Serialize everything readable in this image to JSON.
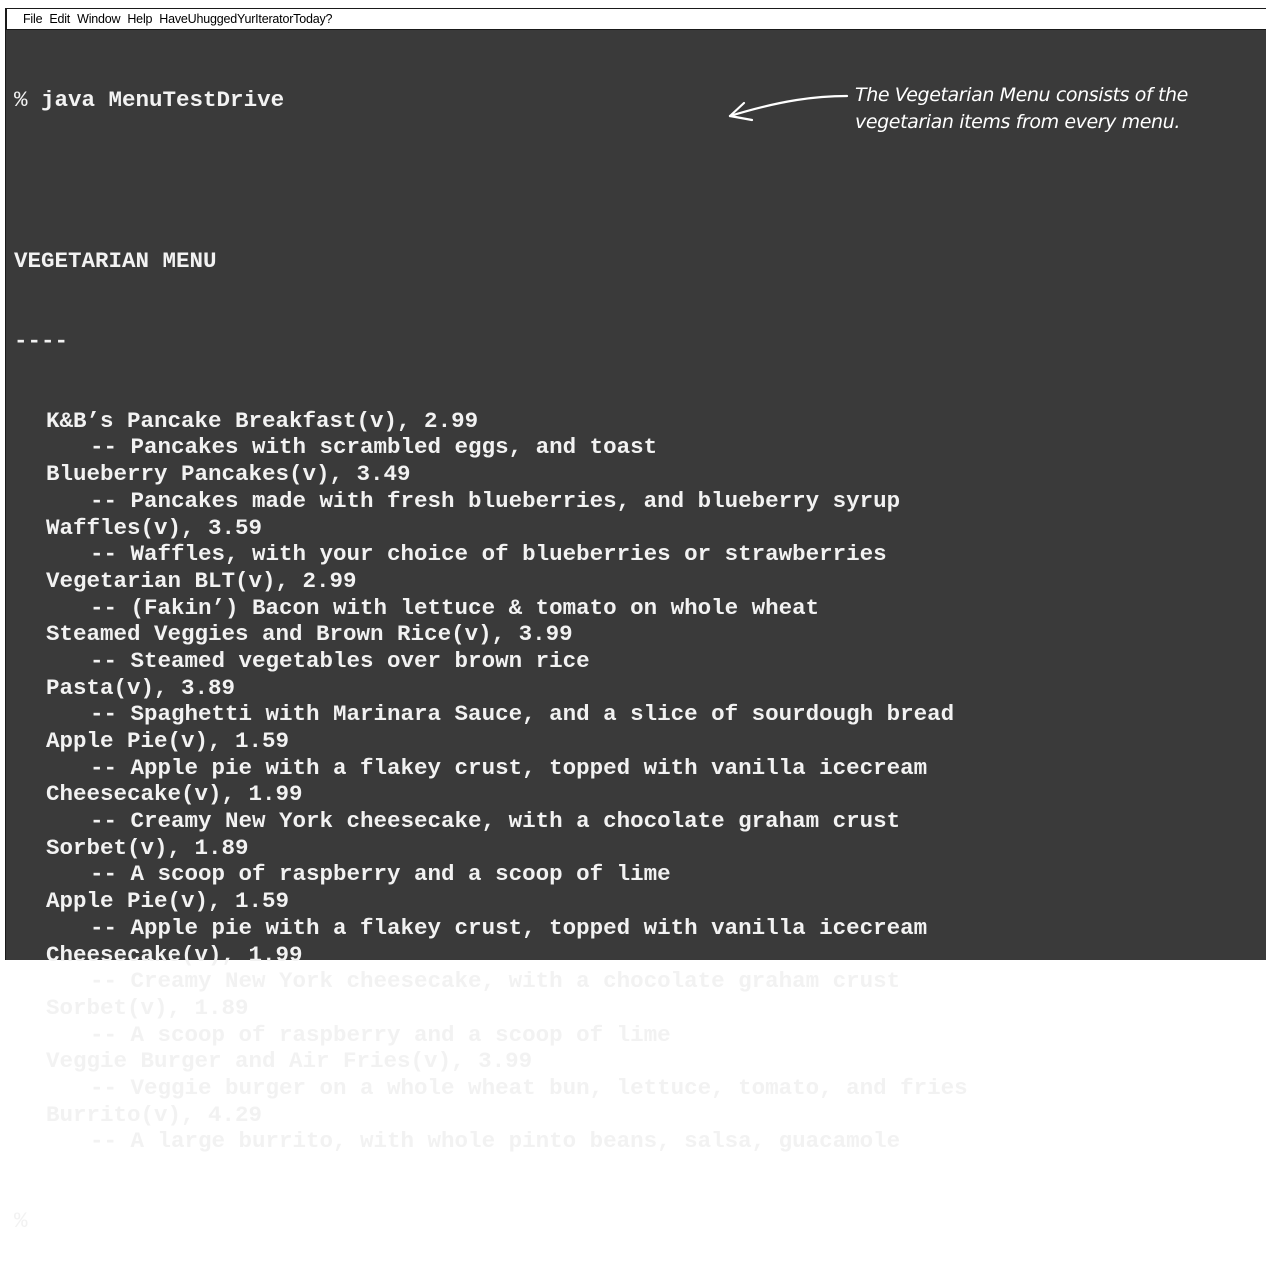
{
  "menubar": {
    "items": [
      "File",
      "Edit",
      "Window",
      "Help",
      "HaveUhuggedYurIteratorToday?"
    ]
  },
  "terminal": {
    "command_prompt": "%",
    "command": "java MenuTestDrive",
    "heading": "VEGETARIAN MENU",
    "separator": "----",
    "items": [
      {
        "name": "K&B’s Pancake Breakfast(v), 2.99",
        "desc": "-- Pancakes with scrambled eggs, and toast"
      },
      {
        "name": "Blueberry Pancakes(v), 3.49",
        "desc": "-- Pancakes made with fresh blueberries, and blueberry syrup"
      },
      {
        "name": "Waffles(v), 3.59",
        "desc": "-- Waffles, with your choice of blueberries or strawberries"
      },
      {
        "name": "Vegetarian BLT(v), 2.99",
        "desc": "-- (Fakin’) Bacon with lettuce & tomato on whole wheat"
      },
      {
        "name": "Steamed Veggies and Brown Rice(v), 3.99",
        "desc": "-- Steamed vegetables over brown rice"
      },
      {
        "name": "Pasta(v), 3.89",
        "desc": "-- Spaghetti with Marinara Sauce, and a slice of sourdough bread"
      },
      {
        "name": "Apple Pie(v), 1.59",
        "desc": "-- Apple pie with a flakey crust, topped with vanilla icecream"
      },
      {
        "name": "Cheesecake(v), 1.99",
        "desc": "-- Creamy New York cheesecake, with a chocolate graham crust"
      },
      {
        "name": "Sorbet(v), 1.89",
        "desc": "-- A scoop of raspberry and a scoop of lime"
      },
      {
        "name": "Apple Pie(v), 1.59",
        "desc": "-- Apple pie with a flakey crust, topped with vanilla icecream"
      },
      {
        "name": "Cheesecake(v), 1.99",
        "desc": "-- Creamy New York cheesecake, with a chocolate graham crust"
      },
      {
        "name": "Sorbet(v), 1.89",
        "desc": "-- A scoop of raspberry and a scoop of lime"
      },
      {
        "name": "Veggie Burger and Air Fries(v), 3.99",
        "desc": "-- Veggie burger on a whole wheat bun, lettuce, tomato, and fries"
      },
      {
        "name": "Burrito(v), 4.29",
        "desc": "-- A large burrito, with whole pinto beans, salsa, guacamole"
      }
    ],
    "final_prompt": "%"
  },
  "annotation": {
    "line1": "The Vegetarian Menu consists of the",
    "line2": "vegetarian items from every menu."
  },
  "colors": {
    "terminal_bg": "#3a3a3a",
    "terminal_fg": "#f2f2f2",
    "menubar_bg": "#ffffff"
  },
  "icons": {
    "annotation_arrow": "arrow-left-icon"
  }
}
